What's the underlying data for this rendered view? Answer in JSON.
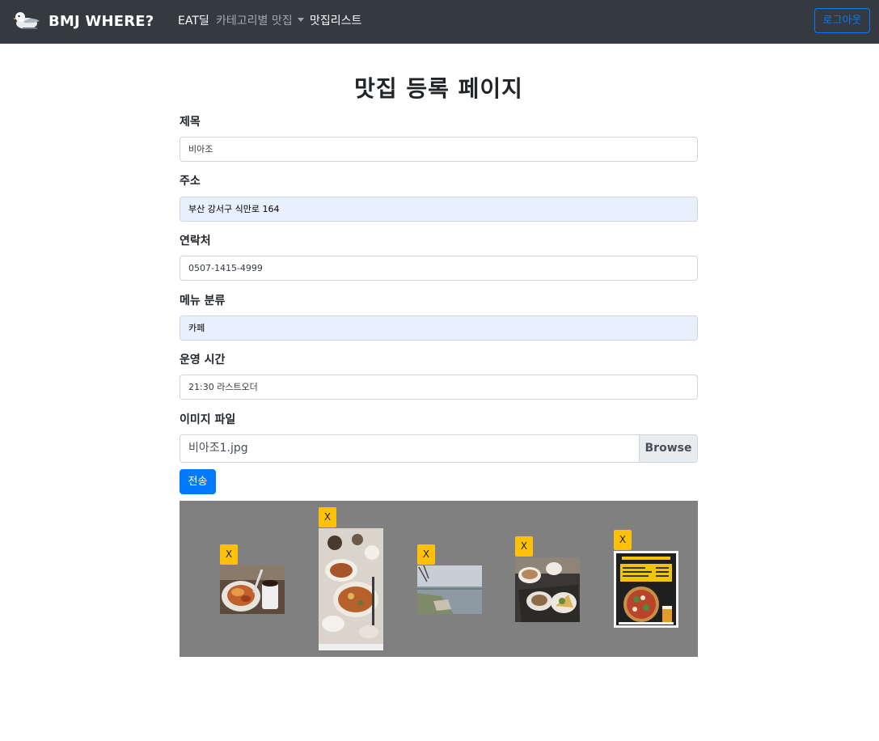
{
  "navbar": {
    "brand": "BMJ WHERE?",
    "links": [
      "EAT딜",
      "카테고리별 맛집",
      "맛집리스트"
    ],
    "logout_label": "로그아웃"
  },
  "page_title": "맛집 등록 페이지",
  "form": {
    "title_label": "제목",
    "title_value": "비아조",
    "address_label": "주소",
    "address_value": "부산 강서구 식만로 164",
    "phone_label": "연락처",
    "phone_value": "0507-1415-4999",
    "menu_label": "메뉴 분류",
    "menu_value": "카페",
    "hours_label": "운영 시간",
    "hours_value": "21:30 라스트오더",
    "image_label": "이미지 파일",
    "file_name": "비아조1.jpg",
    "browse_label": "Browse",
    "submit_label": "전송"
  },
  "preview": {
    "remove_label": "X",
    "images": [
      "food-photo-icon",
      "food-table-photo-icon",
      "riverside-photo-icon",
      "coffee-dessert-photo-icon",
      "pizza-menu-photo-icon"
    ]
  },
  "colors": {
    "navbar_bg": "#343a40",
    "primary": "#007bff",
    "warning": "#ffc107",
    "preview_bg": "#808080",
    "autofill_bg": "#e8f0fe"
  }
}
